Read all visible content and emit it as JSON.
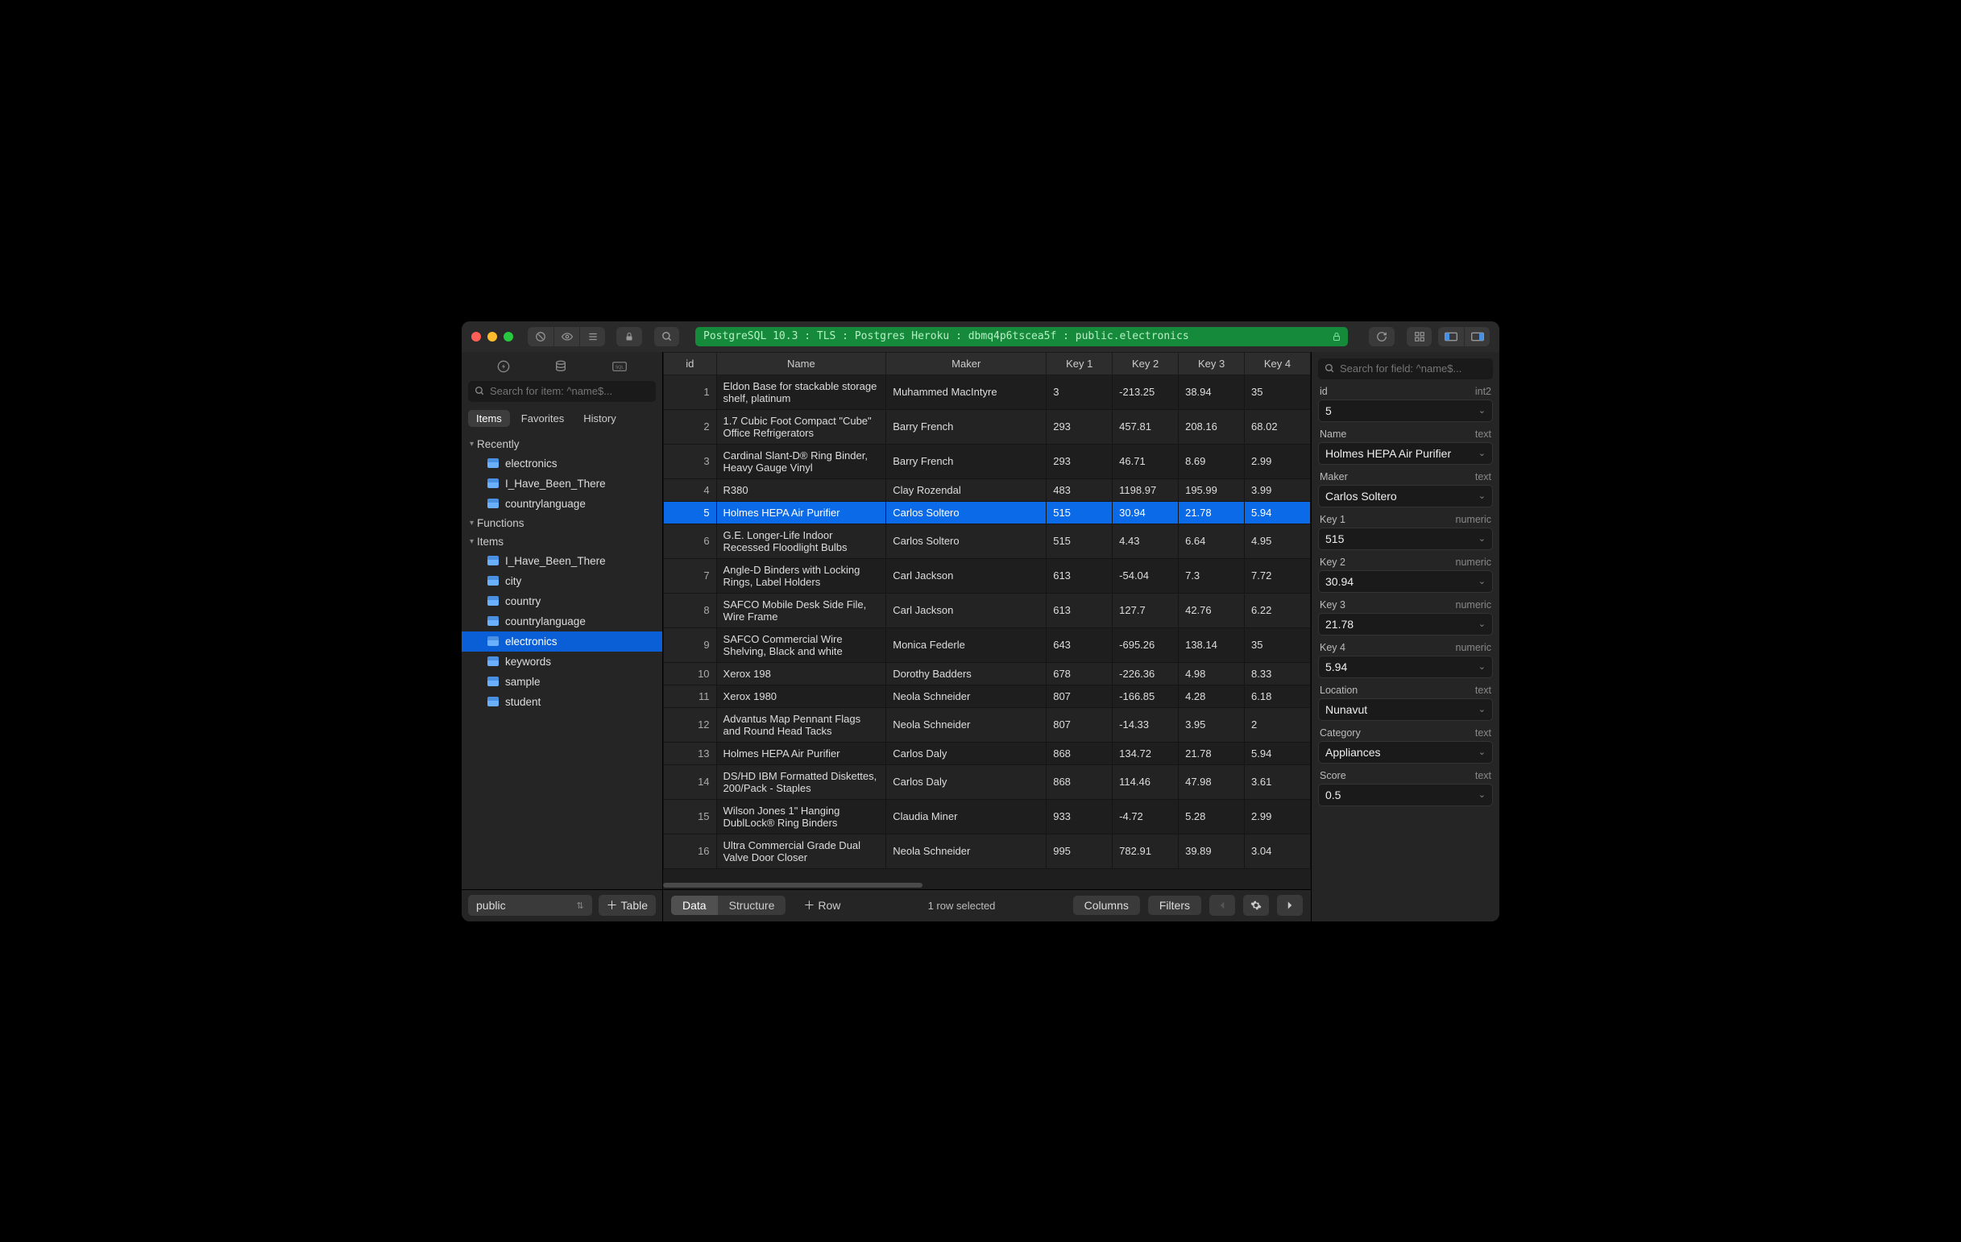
{
  "connection": "PostgreSQL 10.3 : TLS : Postgres Heroku : dbmq4p6tscea5f : public.electronics",
  "sidebar": {
    "search_placeholder": "Search for item: ^name$...",
    "tabs": [
      "Items",
      "Favorites",
      "History"
    ],
    "active_tab": 0,
    "groups": [
      {
        "label": "Recently",
        "items": [
          "electronics",
          "I_Have_Been_There",
          "countrylanguage"
        ]
      },
      {
        "label": "Functions",
        "items": []
      },
      {
        "label": "Items",
        "items": [
          "I_Have_Been_There",
          "city",
          "country",
          "countrylanguage",
          "electronics",
          "keywords",
          "sample",
          "student"
        ]
      }
    ],
    "selected_item": "electronics",
    "schema": "public",
    "add_table_label": "Table"
  },
  "grid": {
    "columns": [
      "id",
      "Name",
      "Maker",
      "Key 1",
      "Key 2",
      "Key 3",
      "Key 4"
    ],
    "selected_row": 5,
    "rows": [
      {
        "id": 1,
        "name": "Eldon Base for stackable storage shelf, platinum",
        "maker": "Muhammed MacIntyre",
        "k1": "3",
        "k2": "-213.25",
        "k3": "38.94",
        "k4": "35"
      },
      {
        "id": 2,
        "name": "1.7 Cubic Foot Compact \"Cube\" Office Refrigerators",
        "maker": "Barry French",
        "k1": "293",
        "k2": "457.81",
        "k3": "208.16",
        "k4": "68.02"
      },
      {
        "id": 3,
        "name": "Cardinal Slant-D® Ring Binder, Heavy Gauge Vinyl",
        "maker": "Barry French",
        "k1": "293",
        "k2": "46.71",
        "k3": "8.69",
        "k4": "2.99"
      },
      {
        "id": 4,
        "name": "R380",
        "maker": "Clay Rozendal",
        "k1": "483",
        "k2": "1198.97",
        "k3": "195.99",
        "k4": "3.99"
      },
      {
        "id": 5,
        "name": "Holmes HEPA Air Purifier",
        "maker": "Carlos Soltero",
        "k1": "515",
        "k2": "30.94",
        "k3": "21.78",
        "k4": "5.94"
      },
      {
        "id": 6,
        "name": "G.E. Longer-Life Indoor Recessed Floodlight Bulbs",
        "maker": "Carlos Soltero",
        "k1": "515",
        "k2": "4.43",
        "k3": "6.64",
        "k4": "4.95"
      },
      {
        "id": 7,
        "name": "Angle-D Binders with Locking Rings, Label Holders",
        "maker": "Carl Jackson",
        "k1": "613",
        "k2": "-54.04",
        "k3": "7.3",
        "k4": "7.72"
      },
      {
        "id": 8,
        "name": "SAFCO Mobile Desk Side File, Wire Frame",
        "maker": "Carl Jackson",
        "k1": "613",
        "k2": "127.7",
        "k3": "42.76",
        "k4": "6.22"
      },
      {
        "id": 9,
        "name": "SAFCO Commercial Wire Shelving, Black and white",
        "maker": "Monica Federle",
        "k1": "643",
        "k2": "-695.26",
        "k3": "138.14",
        "k4": "35"
      },
      {
        "id": 10,
        "name": "Xerox 198",
        "maker": "Dorothy Badders",
        "k1": "678",
        "k2": "-226.36",
        "k3": "4.98",
        "k4": "8.33"
      },
      {
        "id": 11,
        "name": "Xerox 1980",
        "maker": "Neola Schneider",
        "k1": "807",
        "k2": "-166.85",
        "k3": "4.28",
        "k4": "6.18"
      },
      {
        "id": 12,
        "name": "Advantus Map Pennant Flags and Round Head Tacks",
        "maker": "Neola Schneider",
        "k1": "807",
        "k2": "-14.33",
        "k3": "3.95",
        "k4": "2"
      },
      {
        "id": 13,
        "name": "Holmes HEPA Air Purifier",
        "maker": "Carlos Daly",
        "k1": "868",
        "k2": "134.72",
        "k3": "21.78",
        "k4": "5.94"
      },
      {
        "id": 14,
        "name": "DS/HD IBM Formatted Diskettes, 200/Pack - Staples",
        "maker": "Carlos Daly",
        "k1": "868",
        "k2": "114.46",
        "k3": "47.98",
        "k4": "3.61"
      },
      {
        "id": 15,
        "name": "Wilson Jones 1\" Hanging DublLock® Ring Binders",
        "maker": "Claudia Miner",
        "k1": "933",
        "k2": "-4.72",
        "k3": "5.28",
        "k4": "2.99"
      },
      {
        "id": 16,
        "name": "Ultra Commercial Grade Dual Valve Door Closer",
        "maker": "Neola Schneider",
        "k1": "995",
        "k2": "782.91",
        "k3": "39.89",
        "k4": "3.04"
      }
    ]
  },
  "footer": {
    "mode_tabs": [
      "Data",
      "Structure"
    ],
    "active_mode": 0,
    "add_row_label": "Row",
    "status": "1 row selected",
    "columns_label": "Columns",
    "filters_label": "Filters"
  },
  "inspector": {
    "search_placeholder": "Search for field: ^name$...",
    "fields": [
      {
        "label": "id",
        "type": "int2",
        "value": "5"
      },
      {
        "label": "Name",
        "type": "text",
        "value": "Holmes HEPA Air Purifier"
      },
      {
        "label": "Maker",
        "type": "text",
        "value": "Carlos Soltero"
      },
      {
        "label": "Key 1",
        "type": "numeric",
        "value": "515"
      },
      {
        "label": "Key 2",
        "type": "numeric",
        "value": "30.94"
      },
      {
        "label": "Key 3",
        "type": "numeric",
        "value": "21.78"
      },
      {
        "label": "Key 4",
        "type": "numeric",
        "value": "5.94"
      },
      {
        "label": "Location",
        "type": "text",
        "value": "Nunavut"
      },
      {
        "label": "Category",
        "type": "text",
        "value": "Appliances"
      },
      {
        "label": "Score",
        "type": "text",
        "value": "0.5"
      }
    ]
  }
}
